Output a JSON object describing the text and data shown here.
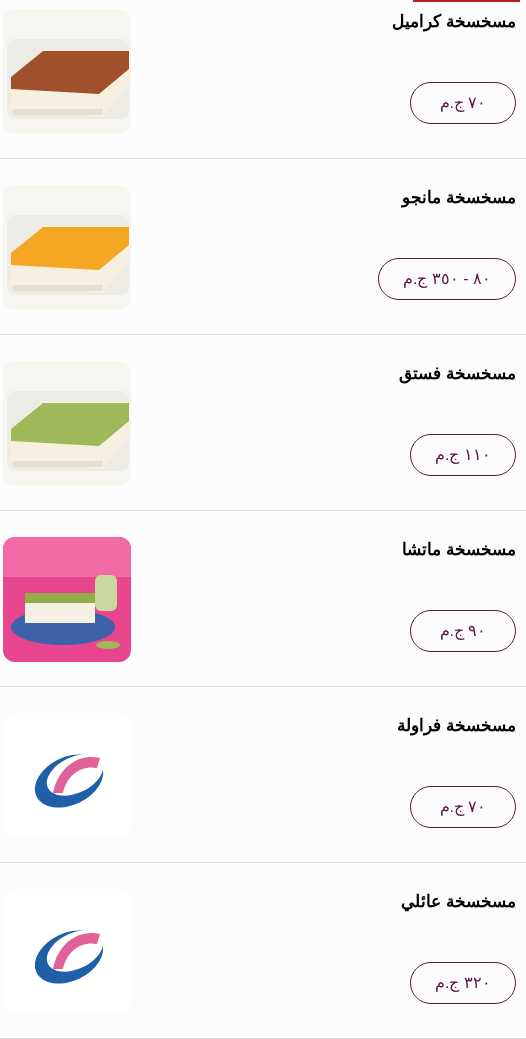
{
  "items": [
    {
      "name": "مسخسخة كراميل",
      "price": "٧٠ ج.م"
    },
    {
      "name": "مسخسخة مانجو",
      "price": "٨٠ - ٣٥٠ ج.م"
    },
    {
      "name": "مسخسخة فستق",
      "price": "١١٠ ج.م"
    },
    {
      "name": "مسخسخة ماتشا",
      "price": "٩٠ ج.م"
    },
    {
      "name": "مسخسخة فراولة",
      "price": "٧٠ ج.م",
      "image": {
        "kind": "logo"
      }
    },
    {
      "name": "مسخسخة عائلي",
      "price": "٣٢٠ ج.م",
      "image": {
        "kind": "logo"
      }
    }
  ]
}
